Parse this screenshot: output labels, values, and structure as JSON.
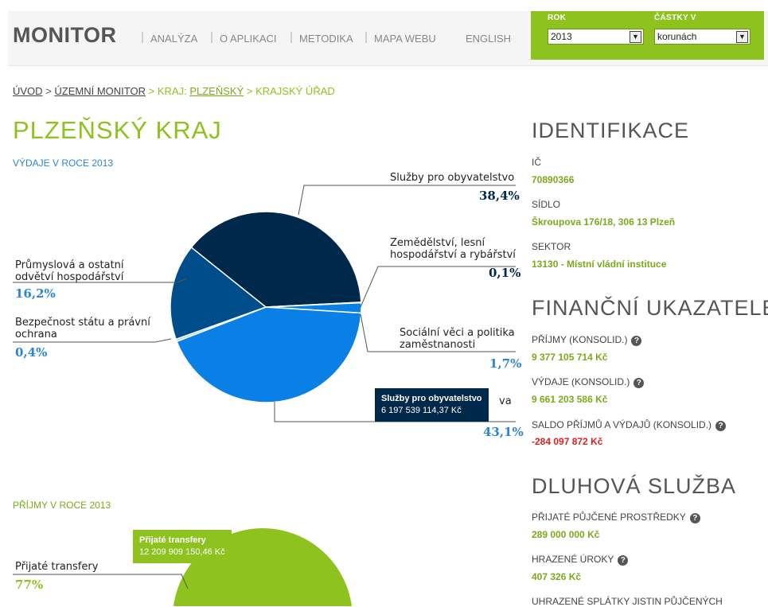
{
  "header": {
    "logo": "MONITOR",
    "nav": [
      "ANALÝZA",
      "O APLIKACI",
      "METODIKA",
      "MAPA WEBU",
      "ENGLISH"
    ],
    "nav_separator": "|",
    "year_label": "ROK",
    "year_value": "2013",
    "amount_label": "ČÁSTKY V",
    "amount_value": "korunách",
    "dropdown_arrow": "▼"
  },
  "breadcrumb": {
    "home": "ÚVOD",
    "sep": ">",
    "territorial": "ÚZEMNÍ MONITOR",
    "region_prefix": "KRAJ:",
    "region": "PLZEŇSKÝ",
    "office": "KRAJSKÝ ÚŘAD"
  },
  "page_title": "PLZEŇSKÝ KRAJ",
  "expenses": {
    "heading": "VÝDAJE V ROCE 2013",
    "labels": {
      "services": "Služby pro obyvatelstvo",
      "agriculture_1": "Zemědělství, lesní",
      "agriculture_2": "hospodářství a rybářství",
      "social_1": "Sociální věci a politika",
      "social_2": "zaměstnanosti",
      "industry_1": "Průmyslová a ostatní",
      "industry_2": "odvětví hospodářství",
      "security_1": "Bezpečnost státu a právní",
      "security_2": "ochrana",
      "hidden_label_fragment": "va"
    },
    "percents": {
      "services": "38,4%",
      "agriculture": "0,1%",
      "social": "1,7%",
      "industry": "16,2%",
      "security": "0,4%",
      "hidden": "43,1%"
    },
    "tooltip": {
      "title": "Služby pro obyvatelstvo",
      "value": "6 197 539 114,37 Kč"
    },
    "colors": {
      "dark": "#00284a",
      "mid": "#004d8c",
      "light": "#0a7fe6",
      "pale": "#9fd0f5"
    }
  },
  "chart_data": {
    "type": "pie",
    "title": "VÝDAJE V ROCE 2013",
    "slices": [
      {
        "label": "Služby pro obyvatelstvo",
        "value": 38.4
      },
      {
        "label": "Zemědělství, lesní hospodářství a rybářství",
        "value": 0.1
      },
      {
        "label": "Sociální věci a politika zaměstnanosti",
        "value": 1.7
      },
      {
        "label": "",
        "value": 43.1
      },
      {
        "label": "Bezpečnost státu a právní ochrana",
        "value": 0.4
      },
      {
        "label": "Průmyslová a ostatní odvětví hospodářství",
        "value": 16.2
      }
    ],
    "unit": "%"
  },
  "income": {
    "heading": "PŘÍJMY V ROCE 2013",
    "label": "Přijaté transfery",
    "percent": "77%",
    "tooltip_title": "Přijaté transfery",
    "tooltip_value": "12 209 909 150,46 Kč",
    "color": "#8dc21f"
  },
  "identification": {
    "heading": "IDENTIFIKACE",
    "ic_label": "IČ",
    "ic_value": "70890366",
    "seat_label": "SÍDLO",
    "seat_value": "Škroupova 176/18, 306 13 Plzeň",
    "sector_label": "SEKTOR",
    "sector_value": "13130 - Místní vládní instituce"
  },
  "financial": {
    "heading": "FINANČNÍ UKAZATELE",
    "revenue_label": "PŘÍJMY (KONSOLID.)",
    "revenue_value": "9 377 105 714 Kč",
    "expense_label": "VÝDAJE (KONSOLID.)",
    "expense_value": "9 661 203 586 Kč",
    "balance_label": "SALDO PŘÍJMŮ A VÝDAJŮ (KONSOLID.)",
    "balance_value": "-284 097 872 Kč",
    "help_glyph": "?"
  },
  "debt": {
    "heading": "DLUHOVÁ SLUŽBA",
    "loans_label": "PŘIJATÉ PŮJČENÉ PROSTŘEDKY",
    "loans_value": "289 000 000 Kč",
    "interest_label": "HRAZENÉ ÚROKY",
    "interest_value": "407 326 Kč",
    "repay_label": "UHRAZENÉ SPLÁTKY JISTIN PŮJČENÝCH"
  }
}
